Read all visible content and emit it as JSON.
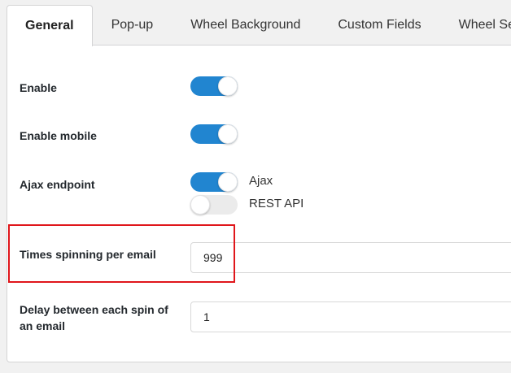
{
  "tabs": [
    {
      "label": "General",
      "active": true
    },
    {
      "label": "Pop-up",
      "active": false
    },
    {
      "label": "Wheel Background",
      "active": false
    },
    {
      "label": "Custom Fields",
      "active": false
    },
    {
      "label": "Wheel Se",
      "active": false
    }
  ],
  "settings": {
    "enable": {
      "label": "Enable",
      "on": true
    },
    "enable_mobile": {
      "label": "Enable mobile",
      "on": true
    },
    "ajax_endpoint": {
      "label": "Ajax endpoint",
      "options": [
        {
          "label": "Ajax",
          "on": true
        },
        {
          "label": "REST API",
          "on": false
        }
      ]
    },
    "times_spinning": {
      "label": "Times spinning per email",
      "value": "999"
    },
    "delay_between_spins": {
      "label_line1": "Delay between each spin of",
      "label_line2": "an email",
      "value": "1"
    }
  },
  "colors": {
    "toggle_on": "#2185d0",
    "toggle_off": "#ebebeb",
    "highlight_border": "#e0161b"
  }
}
